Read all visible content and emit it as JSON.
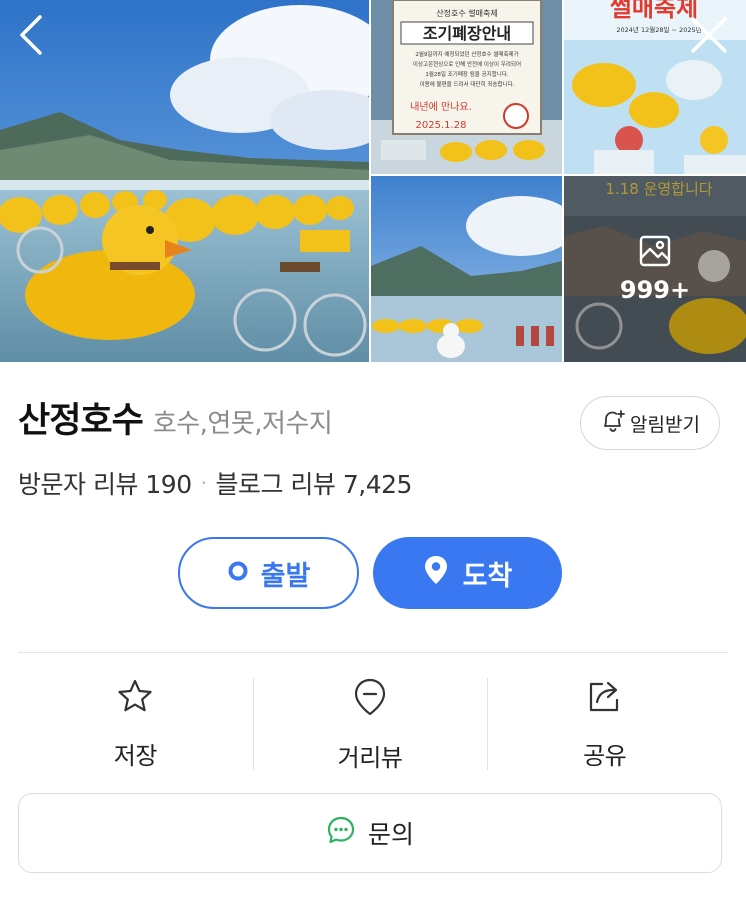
{
  "gallery": {
    "more_count": "999+",
    "notice_photo": {
      "header": "산정호수 썰매축제",
      "title": "조기폐장안내",
      "line1": "2월9일까지 예정되었던 산정호수 썰매축제가",
      "line2": "이상고온현상으로 인해 안전에 이상이 우려되어",
      "line3": "1월28일 조기폐장 됨을 공지합니다.",
      "line4": "이용에 불편을 드려서 대단히 죄송합니다.",
      "footer1": "내년에 만나요.",
      "footer2": "2025.1.28"
    },
    "festival_photo": {
      "title": "썰매축제",
      "dates": "2024년 12월28일 ~ 2025년"
    },
    "operating_photo": {
      "caption": "1.18 운영합니다"
    }
  },
  "place": {
    "name": "산정호수",
    "category": "호수,연못,저수지",
    "visitor_review_label": "방문자 리뷰",
    "visitor_review_count": "190",
    "separator": "·",
    "blog_review_label": "블로그 리뷰",
    "blog_review_count": "7,425"
  },
  "alarm_button": {
    "label": "알림받기"
  },
  "route": {
    "depart_label": "출발",
    "arrive_label": "도착"
  },
  "actions": {
    "save_label": "저장",
    "street_view_label": "거리뷰",
    "share_label": "공유"
  },
  "inquiry": {
    "label": "문의"
  },
  "colors": {
    "accent": "#3a78f2",
    "inquiry_icon": "#2db35f"
  },
  "icons": [
    "back-arrow-icon",
    "close-icon",
    "gallery-icon",
    "bell-plus-icon",
    "location-dot-icon",
    "location-pin-icon",
    "star-icon",
    "street-view-icon",
    "share-icon",
    "chat-bubble-icon"
  ]
}
